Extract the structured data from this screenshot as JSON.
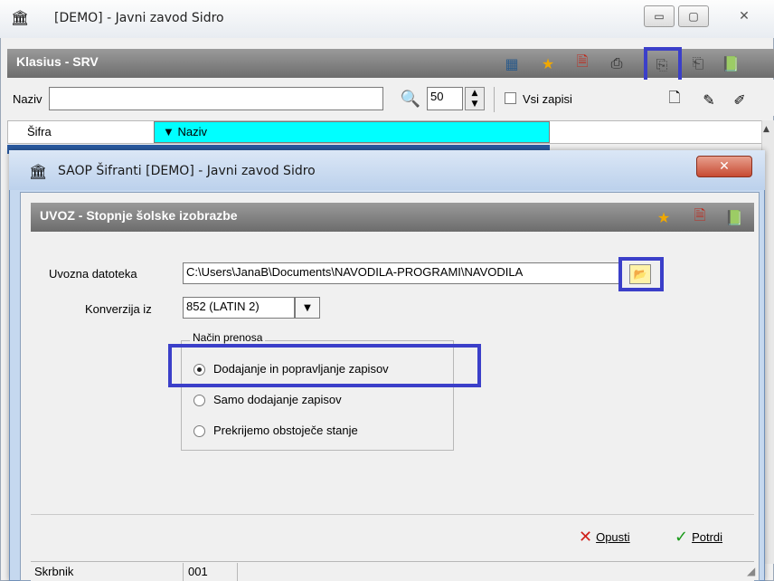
{
  "bg_window": {
    "title": "[DEMO] - Javni zavod Sidro",
    "header_title": "Klasius - SRV",
    "search_label": "Naziv",
    "search_value": "",
    "count_value": "50",
    "all_records_label": "Vsi zapisi",
    "columns": [
      "Šifra",
      "Naziv"
    ]
  },
  "dialog": {
    "window_title": "SAOP Šifranti [DEMO] - Javni zavod Sidro",
    "header_title": "UVOZ - Stopnje šolske izobrazbe",
    "import_file_label": "Uvozna datoteka",
    "import_file_value": "C:\\Users\\JanaB\\Documents\\NAVODILA-PROGRAMI\\NAVODILA",
    "conversion_label": "Konverzija iz",
    "conversion_value": "852 (LATIN 2)",
    "transfer_group_label": "Način prenosa",
    "options": [
      {
        "label": "Dodajanje in popravljanje zapisov",
        "checked": true
      },
      {
        "label": "Samo dodajanje zapisov",
        "checked": false
      },
      {
        "label": "Prekrijemo obstoječe stanje",
        "checked": false
      }
    ],
    "cancel_label": "Opusti",
    "confirm_label": "Potrdi"
  },
  "status": {
    "label": "Skrbnik",
    "value": "001"
  },
  "colors": {
    "highlight": "#3b3fc9",
    "header_gray": "#808080",
    "grid_cyan": "#00ffff"
  }
}
